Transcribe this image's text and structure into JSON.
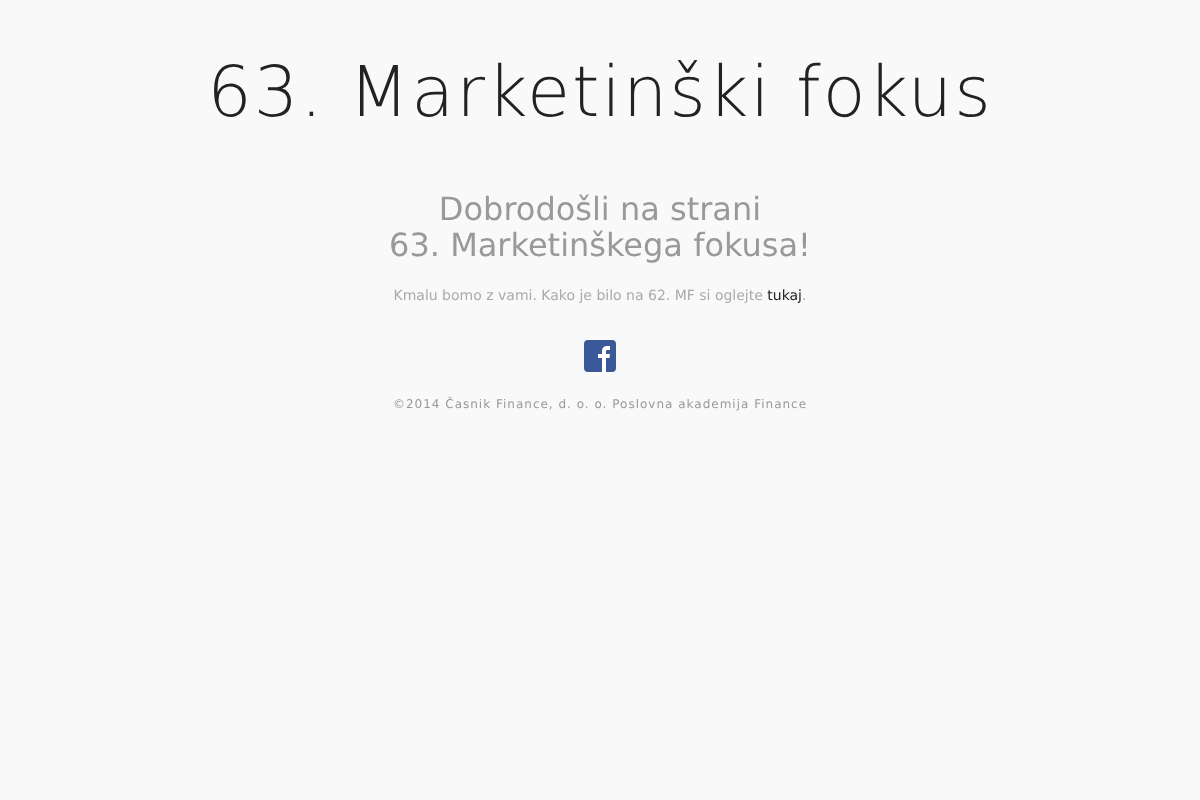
{
  "title": "63. Marketinški fokus",
  "welcome": [
    "Dobrodošli na strani",
    "63. Marketinškega fokusa!"
  ],
  "notice": {
    "text": "Kmalu bomo z vami. Kako je bilo na 62. MF si oglejte ",
    "link": "tukaj",
    "after": "."
  },
  "footer": "©2014 Časnik Finance, d. o. o. Poslovna akademija Finance"
}
